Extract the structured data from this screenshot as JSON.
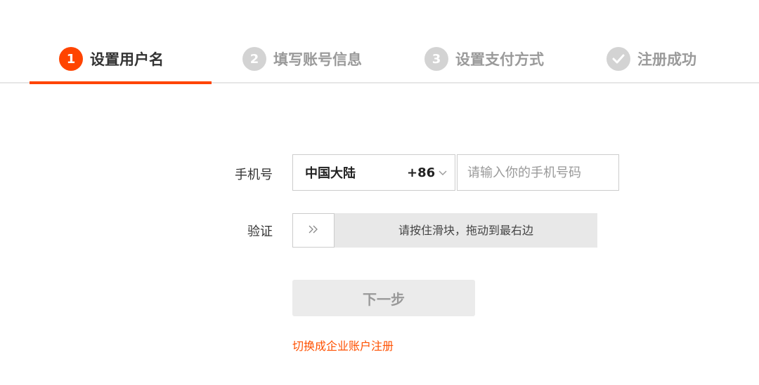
{
  "steps": [
    {
      "number": "1",
      "label": "设置用户名",
      "state": "active",
      "icon": ""
    },
    {
      "number": "2",
      "label": "填写账号信息",
      "state": "pending",
      "icon": ""
    },
    {
      "number": "3",
      "label": "设置支付方式",
      "state": "pending",
      "icon": ""
    },
    {
      "number": "",
      "label": "注册成功",
      "state": "pending",
      "icon": "check-icon"
    }
  ],
  "form": {
    "phone_label": "手机号",
    "country_name": "中国大陆",
    "country_code": "+86",
    "phone_placeholder": "请输入你的手机号码",
    "phone_value": "",
    "verify_label": "验证",
    "slider_hint": "请按住滑块，拖动到最右边",
    "slider_handle_icon": "double-chevron-right-icon",
    "next_label": "下一步",
    "switch_link": "切换成企业账户注册"
  },
  "colors": {
    "accent": "#ff4400",
    "link": "#ff5000",
    "inactive": "#d3d3d3"
  }
}
